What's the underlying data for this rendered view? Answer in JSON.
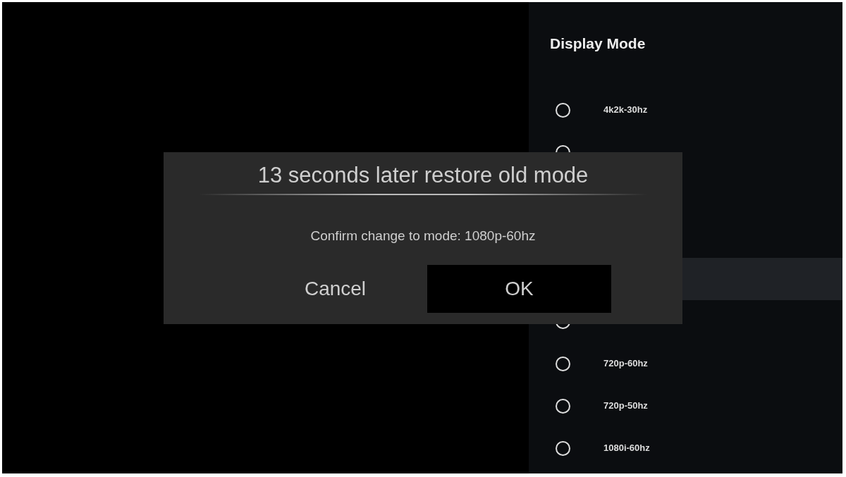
{
  "panel": {
    "title": "Display Mode",
    "modes": [
      {
        "kind": "radio",
        "label": "4k2k-30hz",
        "selected": false
      },
      {
        "kind": "radio",
        "selected": false
      },
      {
        "kind": "blank",
        "selected": false
      },
      {
        "kind": "blank",
        "selected": false
      },
      {
        "kind": "blank",
        "selected": true
      },
      {
        "kind": "radio",
        "selected": false
      },
      {
        "kind": "radio",
        "label": "720p-60hz",
        "selected": false
      },
      {
        "kind": "radio",
        "label": "720p-50hz",
        "selected": false
      },
      {
        "kind": "radio",
        "label": "1080i-60hz",
        "selected": false
      }
    ]
  },
  "dialog": {
    "title": "13 seconds later restore old mode",
    "message": "Confirm change to mode: 1080p-60hz",
    "buttons": [
      {
        "label": "Cancel",
        "focused": false
      },
      {
        "label": "OK",
        "focused": true
      }
    ]
  }
}
